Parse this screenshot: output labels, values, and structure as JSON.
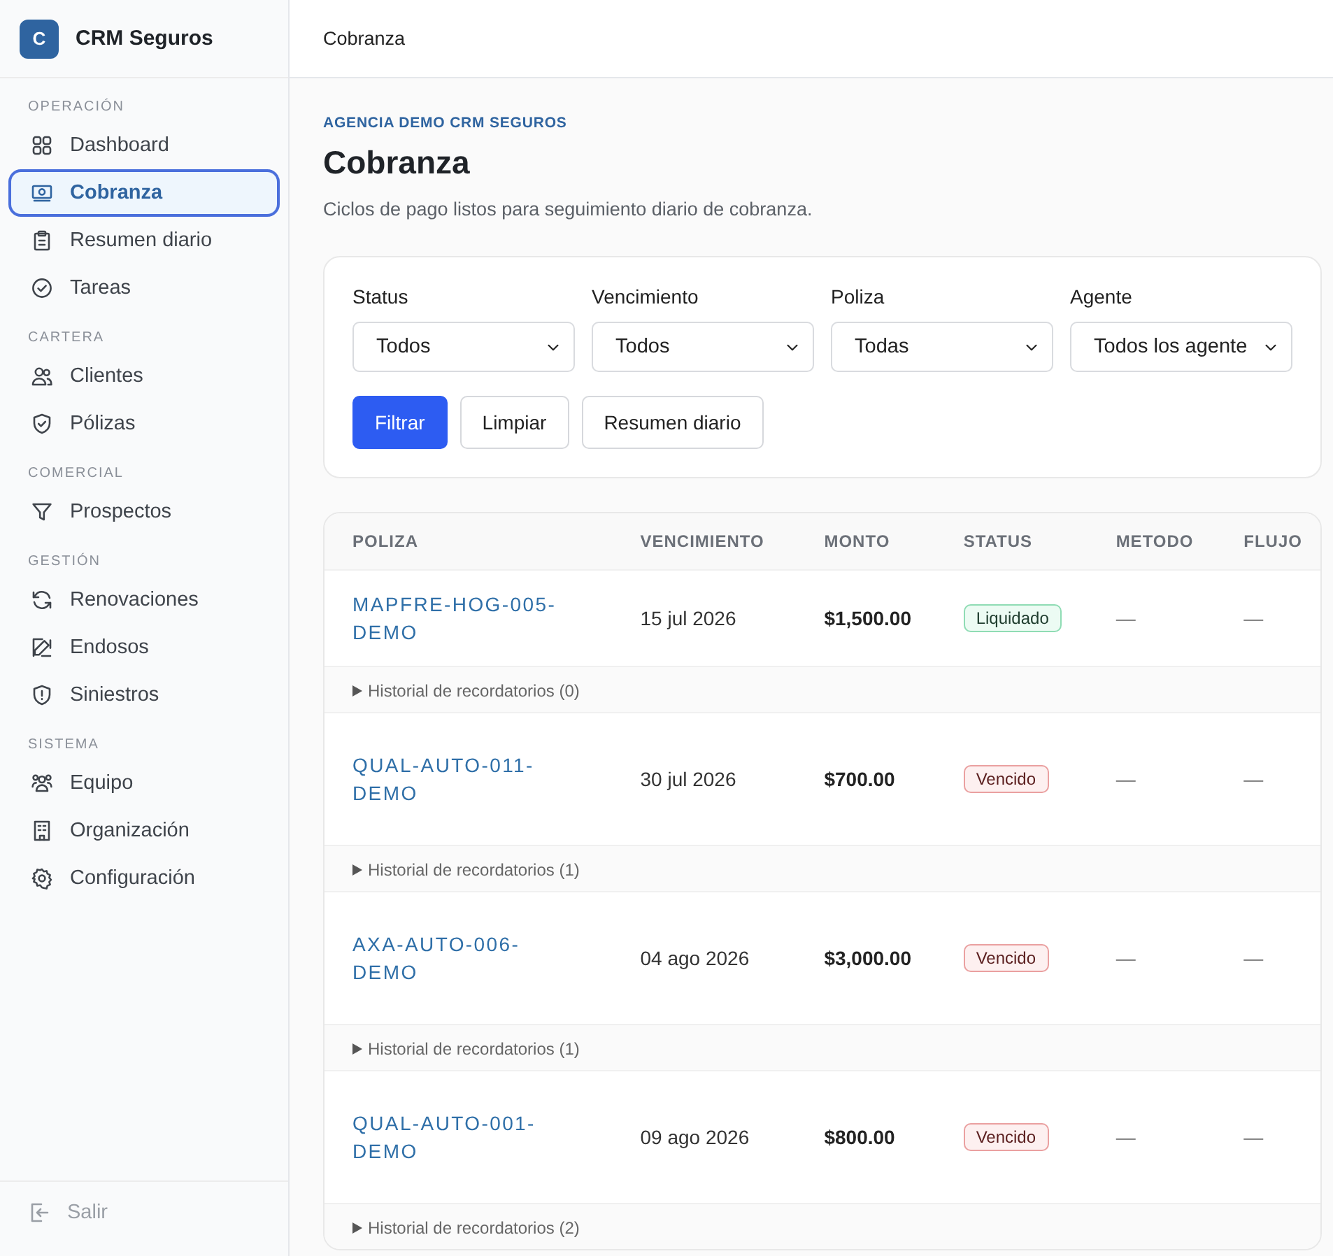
{
  "app": {
    "logo_letter": "C",
    "name": "CRM Seguros"
  },
  "sidebar": {
    "sections": [
      {
        "title": "OPERACIÓN",
        "items": [
          {
            "label": "Dashboard",
            "kind": "grid",
            "selected": false
          },
          {
            "label": "Cobranza",
            "kind": "money",
            "selected": true
          },
          {
            "label": "Resumen diario",
            "kind": "clipboard",
            "selected": false
          },
          {
            "label": "Tareas",
            "kind": "check",
            "selected": false
          }
        ]
      },
      {
        "title": "CARTERA",
        "items": [
          {
            "label": "Clientes",
            "kind": "users",
            "selected": false
          },
          {
            "label": "Pólizas",
            "kind": "shield-check",
            "selected": false
          }
        ]
      },
      {
        "title": "COMERCIAL",
        "items": [
          {
            "label": "Prospectos",
            "kind": "funnel",
            "selected": false
          }
        ]
      },
      {
        "title": "GESTIÓN",
        "items": [
          {
            "label": "Renovaciones",
            "kind": "refresh",
            "selected": false
          },
          {
            "label": "Endosos",
            "kind": "pencil",
            "selected": false
          },
          {
            "label": "Siniestros",
            "kind": "shield-alert",
            "selected": false
          }
        ]
      },
      {
        "title": "SISTEMA",
        "items": [
          {
            "label": "Equipo",
            "kind": "team",
            "selected": false
          },
          {
            "label": "Organización",
            "kind": "building",
            "selected": false
          },
          {
            "label": "Configuración",
            "kind": "gear",
            "selected": false
          }
        ]
      }
    ],
    "footer": {
      "label": "Salir"
    }
  },
  "topbar": {
    "title": "Cobranza"
  },
  "header": {
    "eyebrow": "AGENCIA DEMO CRM SEGUROS",
    "title": "Cobranza",
    "subtitle": "Ciclos de pago listos para seguimiento diario de cobranza."
  },
  "filters": {
    "fields": [
      {
        "label": "Status",
        "value": "Todos"
      },
      {
        "label": "Vencimiento",
        "value": "Todos"
      },
      {
        "label": "Poliza",
        "value": "Todas"
      },
      {
        "label": "Agente",
        "value": "Todos los agente"
      }
    ],
    "buttons": [
      {
        "label": "Filtrar",
        "kind": "primary"
      },
      {
        "label": "Limpiar",
        "kind": "secondary"
      },
      {
        "label": "Resumen diario",
        "kind": "secondary"
      }
    ]
  },
  "table": {
    "columns": [
      "POLIZA",
      "VENCIMIENTO",
      "MONTO",
      "STATUS",
      "METODO",
      "FLUJO"
    ],
    "rows": [
      {
        "poliza": "MAPFRE-HOG-005-DEMO",
        "vencimiento": "15 jul 2026",
        "monto": "$1,500.00",
        "status": {
          "label": "Liquidado",
          "kind": "paid"
        },
        "metodo": "—",
        "flujo": "—",
        "history": "Historial de recordatorios (0)"
      },
      {
        "poliza": "QUAL-AUTO-011-DEMO",
        "vencimiento": "30 jul 2026",
        "monto": "$700.00",
        "status": {
          "label": "Vencido",
          "kind": "overdue"
        },
        "metodo": "—",
        "flujo": "—",
        "history": "Historial de recordatorios (1)"
      },
      {
        "poliza": "AXA-AUTO-006-DEMO",
        "vencimiento": "04 ago 2026",
        "monto": "$3,000.00",
        "status": {
          "label": "Vencido",
          "kind": "overdue"
        },
        "metodo": "—",
        "flujo": "—",
        "history": "Historial de recordatorios (1)"
      },
      {
        "poliza": "QUAL-AUTO-001-DEMO",
        "vencimiento": "09 ago 2026",
        "monto": "$800.00",
        "status": {
          "label": "Vencido",
          "kind": "overdue"
        },
        "metodo": "—",
        "flujo": "—",
        "history": "Historial de recordatorios (2)"
      }
    ]
  }
}
